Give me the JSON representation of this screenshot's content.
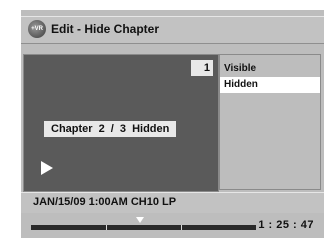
{
  "header": {
    "logo_text": "+VR",
    "title": "Edit - Hide Chapter"
  },
  "preview": {
    "title_number": "1",
    "chapter_info": "Chapter   2 / 3   Hidden",
    "play_icon": "play-icon"
  },
  "menu": {
    "items": [
      {
        "label": "Visible"
      },
      {
        "label": "Hidden"
      }
    ],
    "selected_index": 1
  },
  "status": {
    "info": "JAN/15/09 1:00AM CH10   LP",
    "timecode": "1 : 25 : 47"
  },
  "timeline": {
    "chapters": 3,
    "current_chapter": 2
  }
}
